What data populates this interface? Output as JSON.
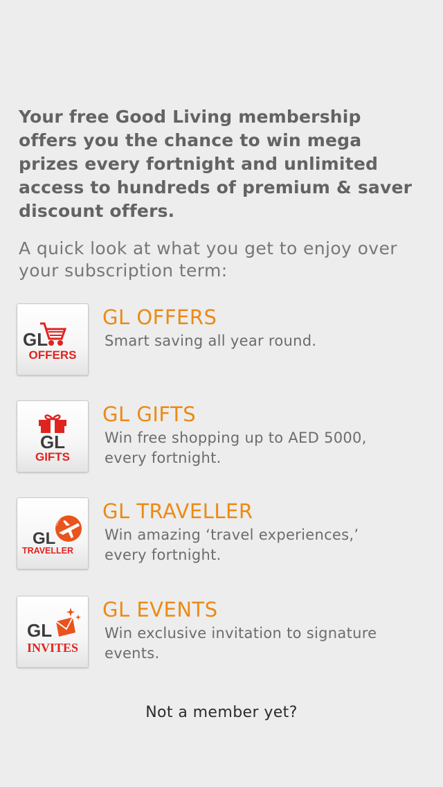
{
  "intro": {
    "line1": "Your free Good Living membership",
    "line2": "offers you the chance to win mega",
    "line3": "prizes every fortnight and unlimited",
    "line4": "access to hundreds of premium & saver",
    "line5": "discount offers."
  },
  "subintro": {
    "line1": "A quick look at what you get to enjoy over",
    "line2": "your subscription term:"
  },
  "features": [
    {
      "icon": "gl-offers-cart-icon",
      "icon_text_top": "GL",
      "icon_text_bottom": "OFFERS",
      "title": "GL OFFERS",
      "desc_line1": "Smart saving all year round.",
      "desc_line2": ""
    },
    {
      "icon": "gl-gifts-box-icon",
      "icon_text_top": "GL",
      "icon_text_bottom": "GIFTS",
      "title": "GL GIFTS",
      "desc_line1": "Win free shopping up to AED 5000,",
      "desc_line2": "every fortnight."
    },
    {
      "icon": "gl-traveller-globe-icon",
      "icon_text_top": "GL",
      "icon_text_bottom": "TRAVELLER",
      "title": "GL TRAVELLER",
      "desc_line1": "Win amazing ‘travel experiences,’",
      "desc_line2": "every fortnight."
    },
    {
      "icon": "gl-invites-envelope-icon",
      "icon_text_top": "GL",
      "icon_text_bottom": "INVITES",
      "title": "GL EVENTS",
      "desc_line1": "Win exclusive invitation to signature",
      "desc_line2": "events."
    }
  ],
  "cta": {
    "label": "Not a member yet?"
  },
  "colors": {
    "background": "#ededed",
    "accent_orange": "#ec8a14",
    "icon_red": "#e0231f",
    "icon_dark": "#3c3c3c",
    "intro_text": "#636363",
    "body_text": "#6c6c6c"
  }
}
